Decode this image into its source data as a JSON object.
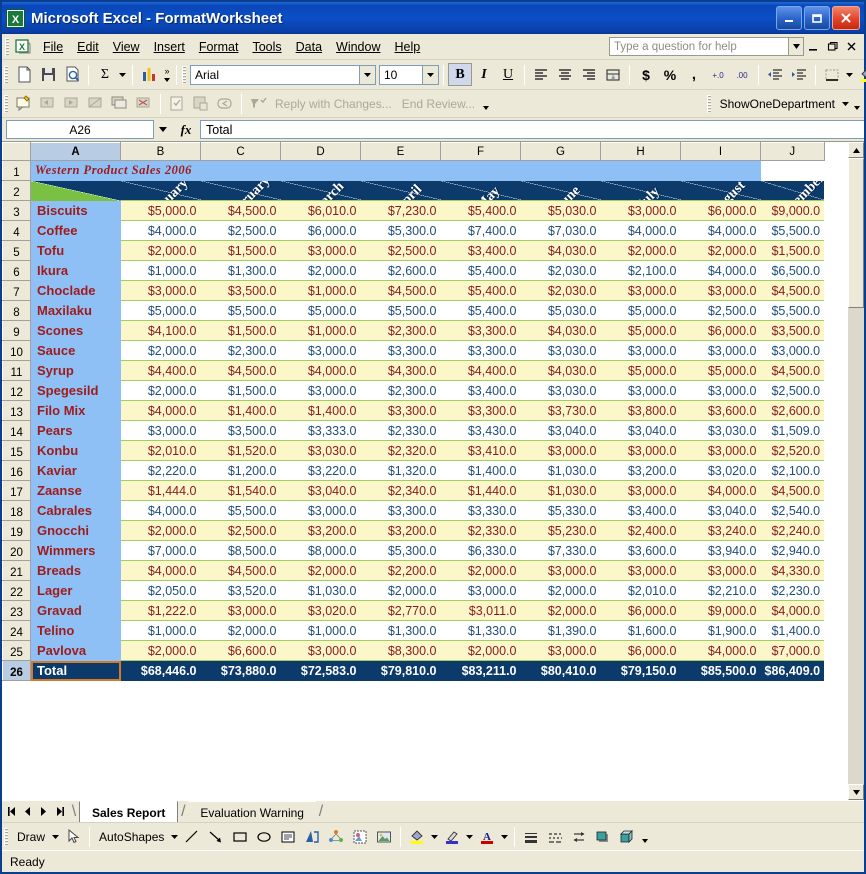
{
  "window": {
    "title": "Microsoft Excel - FormatWorksheet",
    "app_icon": "excel-icon",
    "minimize": "minimize-icon",
    "restore": "restore-icon",
    "close": "close-icon"
  },
  "menubar": {
    "items": [
      {
        "label": "File",
        "accel": "F"
      },
      {
        "label": "Edit",
        "accel": "E"
      },
      {
        "label": "View",
        "accel": "V"
      },
      {
        "label": "Insert",
        "accel": "I"
      },
      {
        "label": "Format",
        "accel": "o"
      },
      {
        "label": "Tools",
        "accel": "T"
      },
      {
        "label": "Data",
        "accel": "D"
      },
      {
        "label": "Window",
        "accel": "W"
      },
      {
        "label": "Help",
        "accel": "H"
      }
    ],
    "ask_placeholder": "Type a question for help",
    "ask_value": "",
    "doc_minimize": "doc-minimize-icon",
    "doc_restore": "doc-restore-icon",
    "doc_close": "doc-close-icon"
  },
  "standard_toolbar": {
    "buttons": [
      {
        "name": "new-button",
        "label": "New"
      },
      {
        "name": "save-button",
        "label": "Save"
      },
      {
        "name": "print-preview-button",
        "label": "Print Preview"
      },
      {
        "name": "autosum-button",
        "label": "AutoSum"
      },
      {
        "name": "chart-wizard-button",
        "label": "Chart Wizard"
      },
      {
        "name": "toolbar-options-button",
        "label": "Toolbar Options"
      }
    ]
  },
  "formatting_toolbar": {
    "font_name": "Arial",
    "font_size": "10",
    "bold": "B",
    "italic": "I",
    "underline": "U",
    "bold_active": true,
    "buttons": [
      {
        "name": "align-left-button",
        "label": "Align Left"
      },
      {
        "name": "align-center-button",
        "label": "Center"
      },
      {
        "name": "align-right-button",
        "label": "Align Right"
      },
      {
        "name": "merge-center-button",
        "label": "Merge and Center"
      },
      {
        "name": "currency-button",
        "label": "Currency Style"
      },
      {
        "name": "percent-button",
        "label": "Percent Style"
      },
      {
        "name": "comma-button",
        "label": "Comma Style"
      },
      {
        "name": "increase-decimal-button",
        "label": "Increase Decimal"
      },
      {
        "name": "decrease-decimal-button",
        "label": "Decrease Decimal"
      },
      {
        "name": "decrease-indent-button",
        "label": "Decrease Indent"
      },
      {
        "name": "increase-indent-button",
        "label": "Increase Indent"
      },
      {
        "name": "borders-button",
        "label": "Borders"
      },
      {
        "name": "fill-color-button",
        "label": "Fill Color"
      },
      {
        "name": "font-color-button",
        "label": "Font Color"
      }
    ]
  },
  "review_toolbar": {
    "reply_with_changes": "Reply with Changes...",
    "end_review": "End Review...",
    "macro_name": "ShowOneDepartment"
  },
  "formula_bar": {
    "name_box": "A26",
    "fx_label": "fx",
    "formula": "Total"
  },
  "grid": {
    "columns": [
      "A",
      "B",
      "C",
      "D",
      "E",
      "F",
      "G",
      "H",
      "I",
      "J"
    ],
    "selected_column": "A",
    "row_numbers": [
      "1",
      "2",
      "3",
      "4",
      "5",
      "6",
      "7",
      "8",
      "9",
      "10",
      "11",
      "12",
      "13",
      "14",
      "15",
      "16",
      "17",
      "18",
      "19",
      "20",
      "21",
      "22",
      "23",
      "24",
      "25",
      "26"
    ],
    "selected_row": "26",
    "title": "Western Product Sales 2006",
    "months": [
      "January",
      "February",
      "March",
      "April",
      "May",
      "June",
      "July",
      "August",
      "September"
    ],
    "corner_label": "",
    "total_label": "Total",
    "colors": {
      "title_bg": "#8fc0f5",
      "title_text": "#9e1b1b",
      "header_navy": "#0b3a6b",
      "header_green": "#7ac143",
      "odd_row_bg": "#fbf7c8",
      "odd_row_text": "#8b1a1a",
      "even_row_bg": "#ffffff",
      "even_row_text": "#1f4e79",
      "product_bg": "#8fc0f5",
      "selection_border": "#d27a2a"
    }
  },
  "chart_data": {
    "type": "table",
    "title": "Western Product Sales 2006",
    "categories": [
      "January",
      "February",
      "March",
      "April",
      "May",
      "June",
      "July",
      "August",
      "September"
    ],
    "rows": [
      {
        "row": "3",
        "product": "Biscuits",
        "values": [
          "$5,000.0",
          "$4,500.0",
          "$6,010.0",
          "$7,230.0",
          "$5,400.0",
          "$5,030.0",
          "$3,000.0",
          "$6,000.0",
          "$9,000.0"
        ]
      },
      {
        "row": "4",
        "product": "Coffee",
        "values": [
          "$4,000.0",
          "$2,500.0",
          "$6,000.0",
          "$5,300.0",
          "$7,400.0",
          "$7,030.0",
          "$4,000.0",
          "$4,000.0",
          "$5,500.0"
        ]
      },
      {
        "row": "5",
        "product": "Tofu",
        "values": [
          "$2,000.0",
          "$1,500.0",
          "$3,000.0",
          "$2,500.0",
          "$3,400.0",
          "$4,030.0",
          "$2,000.0",
          "$2,000.0",
          "$1,500.0"
        ]
      },
      {
        "row": "6",
        "product": "Ikura",
        "values": [
          "$1,000.0",
          "$1,300.0",
          "$2,000.0",
          "$2,600.0",
          "$5,400.0",
          "$2,030.0",
          "$2,100.0",
          "$4,000.0",
          "$6,500.0"
        ]
      },
      {
        "row": "7",
        "product": "Choclade",
        "values": [
          "$3,000.0",
          "$3,500.0",
          "$1,000.0",
          "$4,500.0",
          "$5,400.0",
          "$2,030.0",
          "$3,000.0",
          "$3,000.0",
          "$4,500.0"
        ]
      },
      {
        "row": "8",
        "product": "Maxilaku",
        "values": [
          "$5,000.0",
          "$5,500.0",
          "$5,000.0",
          "$5,500.0",
          "$5,400.0",
          "$5,030.0",
          "$5,000.0",
          "$2,500.0",
          "$5,500.0"
        ]
      },
      {
        "row": "9",
        "product": "Scones",
        "values": [
          "$4,100.0",
          "$1,500.0",
          "$1,000.0",
          "$2,300.0",
          "$3,300.0",
          "$4,030.0",
          "$5,000.0",
          "$6,000.0",
          "$3,500.0"
        ]
      },
      {
        "row": "10",
        "product": "Sauce",
        "values": [
          "$2,000.0",
          "$2,300.0",
          "$3,000.0",
          "$3,300.0",
          "$3,300.0",
          "$3,030.0",
          "$3,000.0",
          "$3,000.0",
          "$3,000.0"
        ]
      },
      {
        "row": "11",
        "product": "Syrup",
        "values": [
          "$4,400.0",
          "$4,500.0",
          "$4,000.0",
          "$4,300.0",
          "$4,400.0",
          "$4,030.0",
          "$5,000.0",
          "$5,000.0",
          "$4,500.0"
        ]
      },
      {
        "row": "12",
        "product": "Spegesild",
        "values": [
          "$2,000.0",
          "$1,500.0",
          "$3,000.0",
          "$2,300.0",
          "$3,400.0",
          "$3,030.0",
          "$3,000.0",
          "$3,000.0",
          "$2,500.0"
        ]
      },
      {
        "row": "13",
        "product": "Filo Mix",
        "values": [
          "$4,000.0",
          "$1,400.0",
          "$1,400.0",
          "$3,300.0",
          "$3,300.0",
          "$3,730.0",
          "$3,800.0",
          "$3,600.0",
          "$2,600.0"
        ]
      },
      {
        "row": "14",
        "product": "Pears",
        "values": [
          "$3,000.0",
          "$3,500.0",
          "$3,333.0",
          "$2,330.0",
          "$3,430.0",
          "$3,040.0",
          "$3,040.0",
          "$3,030.0",
          "$1,509.0"
        ]
      },
      {
        "row": "15",
        "product": "Konbu",
        "values": [
          "$2,010.0",
          "$1,520.0",
          "$3,030.0",
          "$2,320.0",
          "$3,410.0",
          "$3,000.0",
          "$3,000.0",
          "$3,000.0",
          "$2,520.0"
        ]
      },
      {
        "row": "16",
        "product": "Kaviar",
        "values": [
          "$2,220.0",
          "$1,200.0",
          "$3,220.0",
          "$1,320.0",
          "$1,400.0",
          "$1,030.0",
          "$3,200.0",
          "$3,020.0",
          "$2,100.0"
        ]
      },
      {
        "row": "17",
        "product": "Zaanse",
        "values": [
          "$1,444.0",
          "$1,540.0",
          "$3,040.0",
          "$2,340.0",
          "$1,440.0",
          "$1,030.0",
          "$3,000.0",
          "$4,000.0",
          "$4,500.0"
        ]
      },
      {
        "row": "18",
        "product": "Cabrales",
        "values": [
          "$4,000.0",
          "$5,500.0",
          "$3,000.0",
          "$3,300.0",
          "$3,330.0",
          "$5,330.0",
          "$3,400.0",
          "$3,040.0",
          "$2,540.0"
        ]
      },
      {
        "row": "19",
        "product": "Gnocchi",
        "values": [
          "$2,000.0",
          "$2,500.0",
          "$3,200.0",
          "$3,200.0",
          "$2,330.0",
          "$5,230.0",
          "$2,400.0",
          "$3,240.0",
          "$2,240.0"
        ]
      },
      {
        "row": "20",
        "product": "Wimmers",
        "values": [
          "$7,000.0",
          "$8,500.0",
          "$8,000.0",
          "$5,300.0",
          "$6,330.0",
          "$7,330.0",
          "$3,600.0",
          "$3,940.0",
          "$2,940.0"
        ]
      },
      {
        "row": "21",
        "product": "Breads",
        "values": [
          "$4,000.0",
          "$4,500.0",
          "$2,000.0",
          "$2,200.0",
          "$2,000.0",
          "$3,000.0",
          "$3,000.0",
          "$3,000.0",
          "$4,330.0"
        ]
      },
      {
        "row": "22",
        "product": "Lager",
        "values": [
          "$2,050.0",
          "$3,520.0",
          "$1,030.0",
          "$2,000.0",
          "$3,000.0",
          "$2,000.0",
          "$2,010.0",
          "$2,210.0",
          "$2,230.0"
        ]
      },
      {
        "row": "23",
        "product": "Gravad",
        "values": [
          "$1,222.0",
          "$3,000.0",
          "$3,020.0",
          "$2,770.0",
          "$3,011.0",
          "$2,000.0",
          "$6,000.0",
          "$9,000.0",
          "$4,000.0"
        ]
      },
      {
        "row": "24",
        "product": "Telino",
        "values": [
          "$1,000.0",
          "$2,000.0",
          "$1,000.0",
          "$1,300.0",
          "$1,330.0",
          "$1,390.0",
          "$1,600.0",
          "$1,900.0",
          "$1,400.0"
        ]
      },
      {
        "row": "25",
        "product": "Pavlova",
        "values": [
          "$2,000.0",
          "$6,600.0",
          "$3,000.0",
          "$8,300.0",
          "$2,000.0",
          "$3,000.0",
          "$6,000.0",
          "$4,000.0",
          "$7,000.0"
        ]
      }
    ],
    "totals": {
      "row": "26",
      "product": "Total",
      "values": [
        "$68,446.0",
        "$73,880.0",
        "$72,583.0",
        "$79,810.0",
        "$83,211.0",
        "$80,410.0",
        "$79,150.0",
        "$85,500.0",
        "$86,409.0"
      ]
    }
  },
  "sheet_tabs": {
    "tabs": [
      {
        "label": "Sales Report",
        "active": true
      },
      {
        "label": "Evaluation Warning",
        "active": false
      }
    ],
    "nav": [
      "first-sheet-icon",
      "prev-sheet-icon",
      "next-sheet-icon",
      "last-sheet-icon"
    ]
  },
  "drawing_toolbar": {
    "draw_label": "Draw",
    "autoshapes_label": "AutoShapes",
    "buttons": [
      {
        "name": "select-objects-button",
        "label": "Select Objects"
      },
      {
        "name": "line-button",
        "label": "Line"
      },
      {
        "name": "arrow-button",
        "label": "Arrow"
      },
      {
        "name": "rectangle-button",
        "label": "Rectangle"
      },
      {
        "name": "oval-button",
        "label": "Oval"
      },
      {
        "name": "text-box-button",
        "label": "Text Box"
      },
      {
        "name": "wordart-button",
        "label": "Insert WordArt"
      },
      {
        "name": "diagram-button",
        "label": "Insert Diagram"
      },
      {
        "name": "clip-art-button",
        "label": "Insert Clip Art"
      },
      {
        "name": "picture-button",
        "label": "Insert Picture"
      },
      {
        "name": "fill-color-button",
        "label": "Fill Color"
      },
      {
        "name": "line-color-button",
        "label": "Line Color"
      },
      {
        "name": "font-color-button",
        "label": "Font Color"
      },
      {
        "name": "line-style-button",
        "label": "Line Style"
      },
      {
        "name": "dash-style-button",
        "label": "Dash Style"
      },
      {
        "name": "arrow-style-button",
        "label": "Arrow Style"
      },
      {
        "name": "shadow-style-button",
        "label": "Shadow Style"
      },
      {
        "name": "3d-style-button",
        "label": "3-D Style"
      }
    ]
  },
  "statusbar": {
    "message": "Ready"
  }
}
